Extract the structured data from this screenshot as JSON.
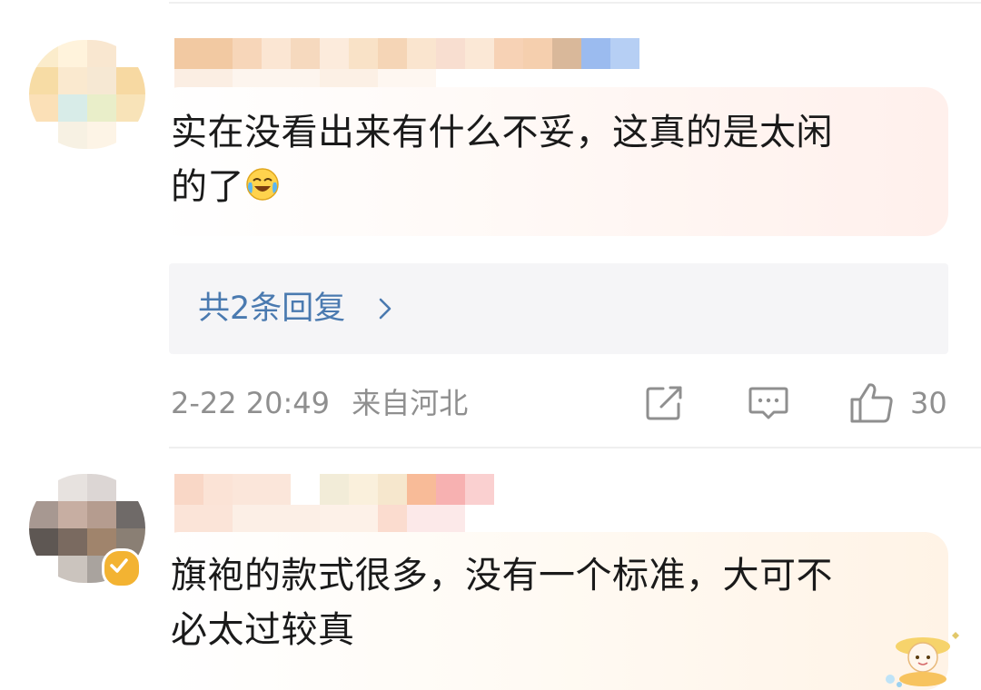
{
  "comments": [
    {
      "text": "实在没看出来有什么不妥，这真的是太闲的了",
      "line1": "实在没看出来有什么不妥，这真的是太闲",
      "line2": "的了",
      "emoji": "laughing-tears-icon",
      "replies_label": "共2条回复",
      "timestamp": "2-22 20:49",
      "location": "来自河北",
      "like_count": "30",
      "actions": [
        "share-icon",
        "comment-icon",
        "thumbs-up-icon"
      ]
    },
    {
      "text": "旗袍的款式很多，没有一个标准，大可不必太过较真",
      "line1": "旗袍的款式很多，没有一个标准，大可不",
      "line2": "必太过较真",
      "badge": "verified-badge-icon",
      "sticker": "sticker-decoration-icon"
    }
  ],
  "colors": {
    "text": "#1a1a1a",
    "link": "#4a7ab0",
    "meta": "#8f8f8f",
    "reply_bg": "#f5f5f7",
    "badge": "#f3b332"
  }
}
